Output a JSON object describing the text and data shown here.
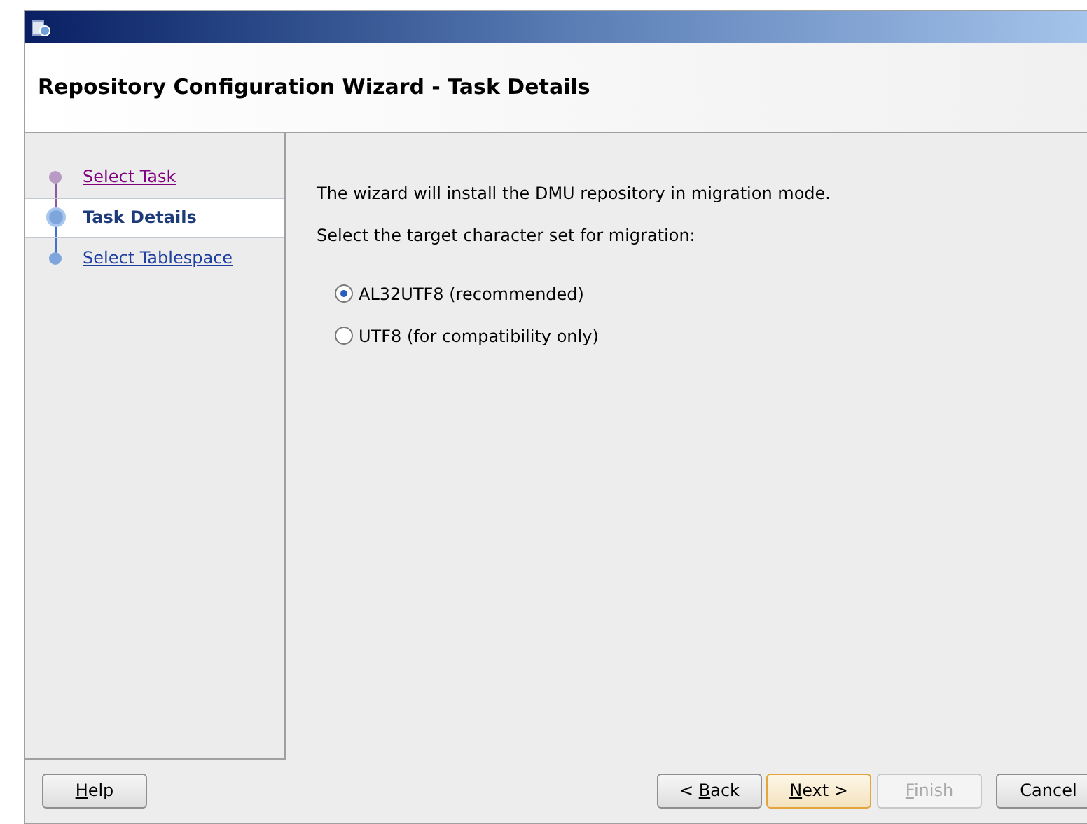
{
  "window": {
    "title_icon": true
  },
  "header": {
    "title": "Repository Configuration Wizard - Task Details"
  },
  "steps": [
    {
      "label": "Select Task",
      "selected": false,
      "visited": true
    },
    {
      "label": "Task Details",
      "selected": true,
      "visited": false
    },
    {
      "label": "Select Tablespace",
      "selected": false,
      "visited": false
    }
  ],
  "content": {
    "intro": "The wizard will install the DMU repository in migration mode.",
    "prompt": "Select the target character set for migration:",
    "options": [
      {
        "label": "AL32UTF8 (recommended)",
        "selected": true
      },
      {
        "label": "UTF8 (for compatibility only)",
        "selected": false
      }
    ]
  },
  "left_buttons": [
    {
      "key": "H",
      "after": "elp",
      "disabled": false,
      "default": false
    }
  ],
  "right_buttons": [
    {
      "before": "< ",
      "key": "B",
      "after": "ack",
      "disabled": false,
      "default": false
    },
    {
      "key": "N",
      "after": "ext >",
      "disabled": false,
      "default": true
    },
    {
      "key": "F",
      "after": "inish",
      "disabled": true,
      "default": false
    },
    {
      "before": "Cancel",
      "disabled": false,
      "default": false
    }
  ]
}
